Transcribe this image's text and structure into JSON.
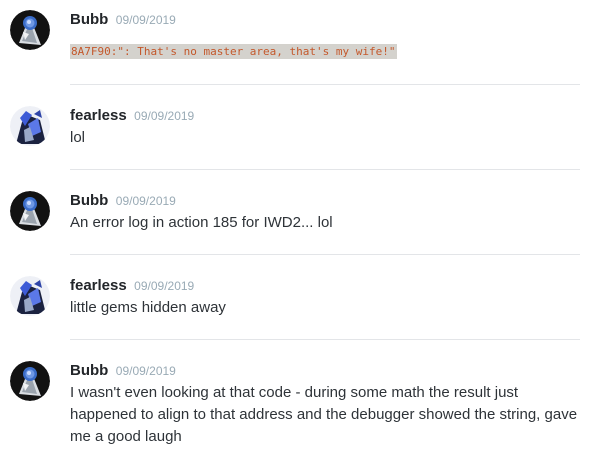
{
  "messages": [
    {
      "author": "Bubb",
      "timestamp": "09/09/2019",
      "avatar": "bubb-avatar",
      "content": "8A7F90:\": That's no master area, that's my wife!\"",
      "is_code": true
    },
    {
      "author": "fearless",
      "timestamp": "09/09/2019",
      "avatar": "fearless-avatar",
      "content": "lol",
      "is_code": false
    },
    {
      "author": "Bubb",
      "timestamp": "09/09/2019",
      "avatar": "bubb-avatar",
      "content": "An error log in action 185 for IWD2... lol",
      "is_code": false
    },
    {
      "author": "fearless",
      "timestamp": "09/09/2019",
      "avatar": "fearless-avatar",
      "content": "little gems hidden away",
      "is_code": false
    },
    {
      "author": "Bubb",
      "timestamp": "09/09/2019",
      "avatar": "bubb-avatar",
      "content": "I wasn't even looking at that code - during some math the result just happened to align to that address and the debugger showed the string, gave me a good laugh",
      "is_code": false
    }
  ],
  "colors": {
    "author": "#23262a",
    "timestamp": "#99aab5",
    "text": "#2e3338",
    "code_bg": "#d4d2cd",
    "code_text": "#c4582b",
    "divider": "#e3e5e8"
  }
}
